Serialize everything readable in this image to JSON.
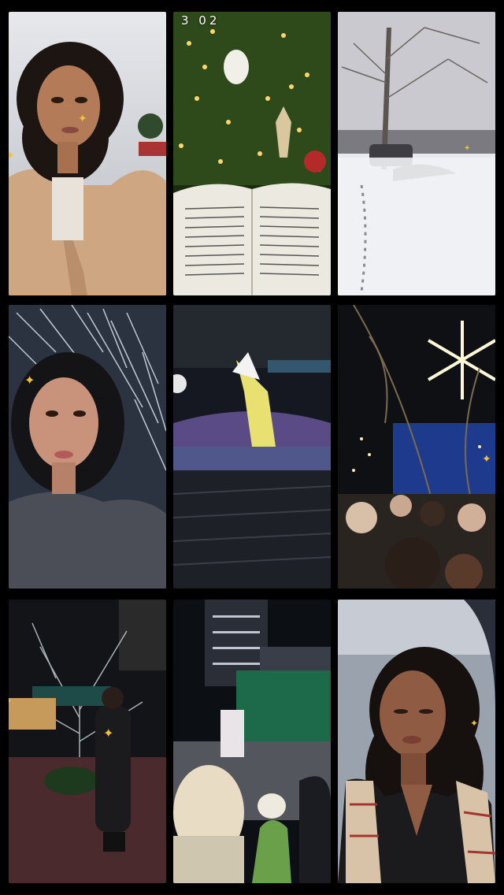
{
  "collage": {
    "title": "",
    "tiles": [
      {
        "name": "selfie-tan-coat",
        "stamp": ""
      },
      {
        "name": "christmas-tree-book",
        "stamp": "3 02"
      },
      {
        "name": "snowy-park",
        "stamp": ""
      },
      {
        "name": "selfie-light-tunnel",
        "stamp": ""
      },
      {
        "name": "stadium-light-show",
        "stamp": ""
      },
      {
        "name": "snowflake-crowd",
        "stamp": ""
      },
      {
        "name": "night-tree-lights",
        "stamp": ""
      },
      {
        "name": "city-street-crowd",
        "stamp": ""
      },
      {
        "name": "selfie-car-scarf",
        "stamp": ""
      }
    ]
  },
  "colors": {
    "background": "#000000",
    "sparkle": "#f2c23a"
  },
  "icons": [
    "sparkle-icon"
  ]
}
